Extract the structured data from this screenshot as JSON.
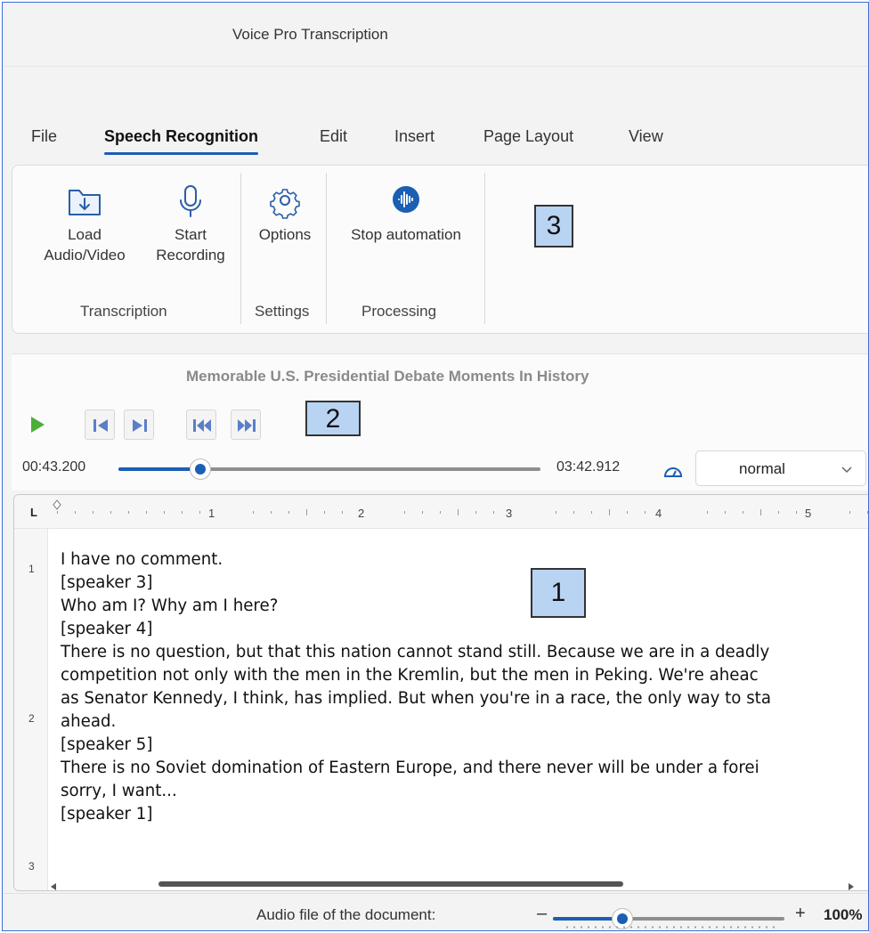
{
  "window": {
    "title": "Voice Pro Transcription"
  },
  "menu": {
    "tabs": [
      {
        "label": "File",
        "active": false
      },
      {
        "label": "Speech Recognition",
        "active": true
      },
      {
        "label": "Edit",
        "active": false
      },
      {
        "label": "Insert",
        "active": false
      },
      {
        "label": "Page Layout",
        "active": false
      },
      {
        "label": "View",
        "active": false
      }
    ]
  },
  "ribbon": {
    "groups": [
      {
        "label": "Transcription",
        "buttons": [
          {
            "label_line1": "Load",
            "label_line2": "Audio/Video",
            "icon": "folder-download-icon"
          },
          {
            "label_line1": "Start",
            "label_line2": "Recording",
            "icon": "microphone-icon"
          }
        ]
      },
      {
        "label": "Settings",
        "buttons": [
          {
            "label_line1": "Options",
            "icon": "gear-icon"
          }
        ]
      },
      {
        "label": "Processing",
        "buttons": [
          {
            "label_line1": "Stop automation",
            "icon": "audio-wave-icon"
          }
        ]
      }
    ]
  },
  "badges": {
    "one": "1",
    "two": "2",
    "three": "3"
  },
  "player": {
    "media_title": "Memorable U.S. Presidential Debate Moments In History",
    "current_time": "00:43.200",
    "total_time": "03:42.912",
    "progress_fraction": 0.195,
    "speed": "normal",
    "buttons": [
      "play-icon",
      "skip-back-icon",
      "skip-forward-icon",
      "rewind-icon",
      "fast-forward-icon"
    ]
  },
  "editor": {
    "ruler_numbers": [
      "1",
      "2",
      "3",
      "4",
      "5"
    ],
    "vruler_numbers": [
      "1",
      "2",
      "3"
    ],
    "lines": [
      "I have no comment.",
      "[speaker 3]",
      "Who am I? Why am I here?",
      "[speaker 4]",
      "There is no question, but that this nation cannot stand still. Because we are in a deadly",
      "competition not only with the men in the Kremlin, but the men in Peking. We're aheac",
      "as Senator Kennedy, I think, has implied. But when you're in a race, the only way to sta",
      "ahead.",
      "[speaker 5]",
      "There is no Soviet domination of Eastern Europe, and there never will be under a forei",
      "sorry, I want...",
      "[speaker 1]"
    ]
  },
  "status": {
    "label": "Audio file of the document:",
    "zoom_minus": "–",
    "zoom_plus": "+",
    "zoom_percent": "100%",
    "zoom_fraction": 0.3
  },
  "colors": {
    "accent": "#1a5fb4",
    "badge": "#b9d4f3",
    "play": "#4caf3a"
  }
}
